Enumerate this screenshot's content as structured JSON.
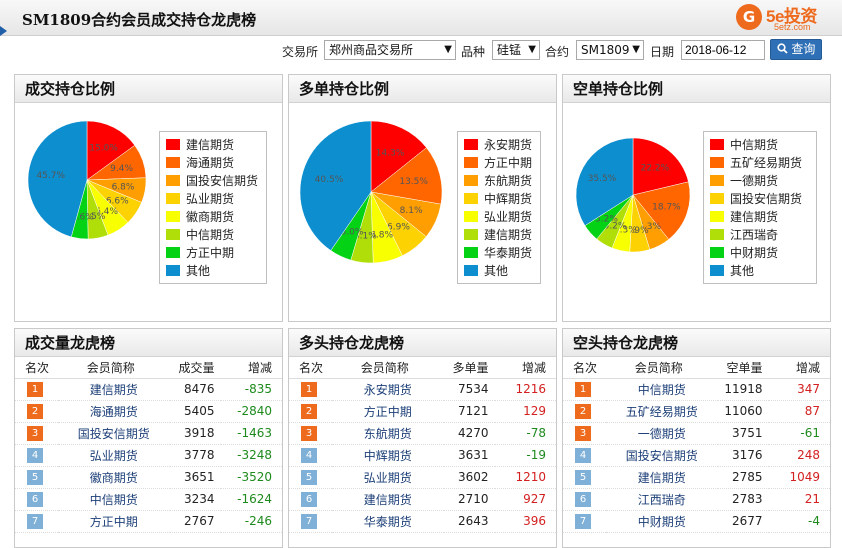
{
  "header": {
    "title": "SM1809合约会员成交持仓龙虎榜"
  },
  "logo": {
    "circle_char": "G",
    "main": "5e投资",
    "sub": "5etz.com",
    "mark": "■"
  },
  "filters": {
    "exchange_label": "交易所",
    "exchange_value": "郑州商品交易所",
    "product_label": "品种",
    "product_value": "硅锰",
    "contract_label": "合约",
    "contract_value": "SM1809",
    "date_label": "日期",
    "date_value": "2018-06-12",
    "query_label": "查询"
  },
  "pies": [
    {
      "title": "成交持仓比例",
      "slices": [
        {
          "name": "建信期货",
          "pct": 15.0,
          "color": "#ff0000"
        },
        {
          "name": "海通期货",
          "pct": 9.4,
          "color": "#ff6600"
        },
        {
          "name": "国投安信期货",
          "pct": 6.8,
          "color": "#ff9e01"
        },
        {
          "name": "弘业期货",
          "pct": 6.6,
          "color": "#fcd202"
        },
        {
          "name": "徽商期货",
          "pct": 6.4,
          "color": "#f8ff01"
        },
        {
          "name": "中信期货",
          "pct": 5.5,
          "color": "#b0de09"
        },
        {
          "name": "方正中期",
          "pct": 4.6,
          "color": "#04d215"
        },
        {
          "name": "其他",
          "pct": 45.7,
          "color": "#0d8ecf"
        }
      ]
    },
    {
      "title": "多单持仓比例",
      "slices": [
        {
          "name": "永安期货",
          "pct": 14.3,
          "color": "#ff0000"
        },
        {
          "name": "方正中期",
          "pct": 13.5,
          "color": "#ff6600"
        },
        {
          "name": "东航期货",
          "pct": 8.1,
          "color": "#ff9e01"
        },
        {
          "name": "中辉期货",
          "pct": 6.9,
          "color": "#fcd202"
        },
        {
          "name": "弘业期货",
          "pct": 6.8,
          "color": "#f8ff01"
        },
        {
          "name": "建信期货",
          "pct": 5.1,
          "color": "#b0de09"
        },
        {
          "name": "华泰期货",
          "pct": 5.0,
          "color": "#04d215"
        },
        {
          "name": "其他",
          "pct": 40.5,
          "color": "#0d8ecf"
        }
      ]
    },
    {
      "title": "空单持仓比例",
      "slices": [
        {
          "name": "中信期货",
          "pct": 22.2,
          "color": "#ff0000"
        },
        {
          "name": "五矿经易期货",
          "pct": 18.7,
          "color": "#ff6600"
        },
        {
          "name": "一德期货",
          "pct": 6.3,
          "color": "#ff9e01"
        },
        {
          "name": "国投安信期货",
          "pct": 5.9,
          "color": "#fcd202"
        },
        {
          "name": "建信期货",
          "pct": 5.3,
          "color": "#f8ff01"
        },
        {
          "name": "江西瑞奇",
          "pct": 5.2,
          "color": "#b0de09"
        },
        {
          "name": "中财期货",
          "pct": 5.2,
          "color": "#04d215"
        },
        {
          "name": "其他",
          "pct": 35.5,
          "color": "#0d8ecf"
        }
      ]
    }
  ],
  "tables": [
    {
      "title": "成交量龙虎榜",
      "headers": [
        "名次",
        "会员简称",
        "成交量",
        "增减"
      ],
      "rows": [
        {
          "rank": "1",
          "member": "建信期货",
          "value": "8476",
          "change": "-835"
        },
        {
          "rank": "2",
          "member": "海通期货",
          "value": "5405",
          "change": "-2840"
        },
        {
          "rank": "3",
          "member": "国投安信期货",
          "value": "3918",
          "change": "-1463"
        },
        {
          "rank": "4",
          "member": "弘业期货",
          "value": "3778",
          "change": "-3248"
        },
        {
          "rank": "5",
          "member": "徽商期货",
          "value": "3651",
          "change": "-3520"
        },
        {
          "rank": "6",
          "member": "中信期货",
          "value": "3234",
          "change": "-1624"
        },
        {
          "rank": "7",
          "member": "方正中期",
          "value": "2767",
          "change": "-246"
        }
      ]
    },
    {
      "title": "多头持仓龙虎榜",
      "headers": [
        "名次",
        "会员简称",
        "多单量",
        "增减"
      ],
      "rows": [
        {
          "rank": "1",
          "member": "永安期货",
          "value": "7534",
          "change": "1216"
        },
        {
          "rank": "2",
          "member": "方正中期",
          "value": "7121",
          "change": "129"
        },
        {
          "rank": "3",
          "member": "东航期货",
          "value": "4270",
          "change": "-78"
        },
        {
          "rank": "4",
          "member": "中辉期货",
          "value": "3631",
          "change": "-19"
        },
        {
          "rank": "5",
          "member": "弘业期货",
          "value": "3602",
          "change": "1210"
        },
        {
          "rank": "6",
          "member": "建信期货",
          "value": "2710",
          "change": "927"
        },
        {
          "rank": "7",
          "member": "华泰期货",
          "value": "2643",
          "change": "396"
        }
      ]
    },
    {
      "title": "空头持仓龙虎榜",
      "headers": [
        "名次",
        "会员简称",
        "空单量",
        "增减"
      ],
      "rows": [
        {
          "rank": "1",
          "member": "中信期货",
          "value": "11918",
          "change": "347"
        },
        {
          "rank": "2",
          "member": "五矿经易期货",
          "value": "11060",
          "change": "87"
        },
        {
          "rank": "3",
          "member": "一德期货",
          "value": "3751",
          "change": "-61"
        },
        {
          "rank": "4",
          "member": "国投安信期货",
          "value": "3176",
          "change": "248"
        },
        {
          "rank": "5",
          "member": "建信期货",
          "value": "2785",
          "change": "1049"
        },
        {
          "rank": "6",
          "member": "江西瑞奇",
          "value": "2783",
          "change": "21"
        },
        {
          "rank": "7",
          "member": "中财期货",
          "value": "2677",
          "change": "-4"
        }
      ]
    }
  ]
}
